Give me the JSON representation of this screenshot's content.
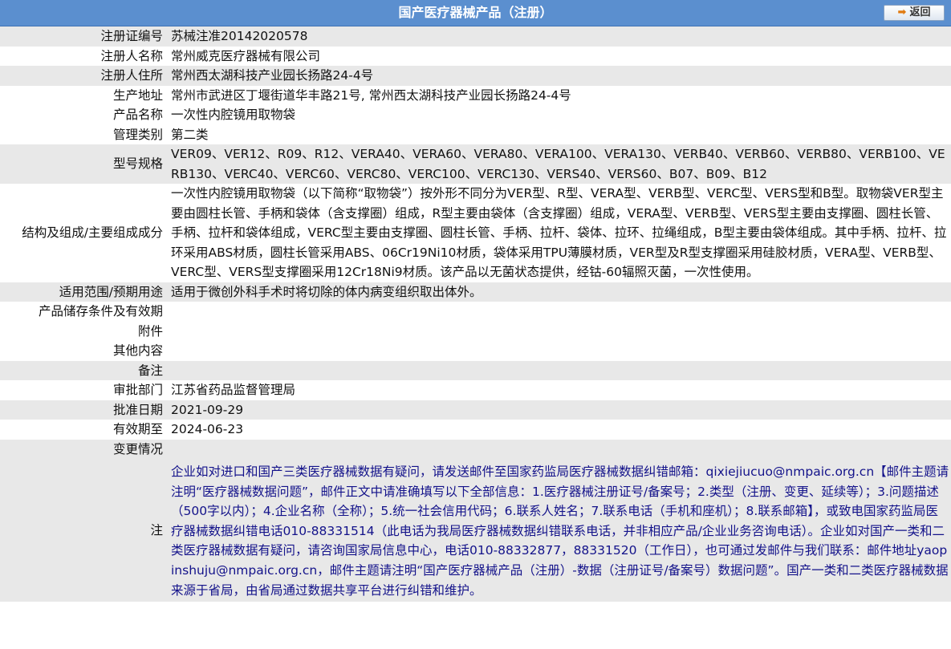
{
  "header": {
    "title": "国产医疗器械产品（注册）",
    "back_label": "返回"
  },
  "rows": [
    {
      "label": "注册证编号",
      "value": "苏械注准20142020578"
    },
    {
      "label": "注册人名称",
      "value": "常州威克医疗器械有限公司"
    },
    {
      "label": "注册人住所",
      "value": "常州西太湖科技产业园长扬路24-4号"
    },
    {
      "label": "生产地址",
      "value": "常州市武进区丁堰街道华丰路21号, 常州西太湖科技产业园长扬路24-4号"
    },
    {
      "label": "产品名称",
      "value": "一次性内腔镜用取物袋"
    },
    {
      "label": "管理类别",
      "value": "第二类"
    },
    {
      "label": "型号规格",
      "value": "VER09、VER12、R09、R12、VERA40、VERA60、VERA80、VERA100、VERA130、VERB40、VERB60、VERB80、VERB100、VERB130、VERC40、VERC60、VERC80、VERC100、VERC130、VERS40、VERS60、B07、B09、B12"
    },
    {
      "label": "结构及组成/主要组成成分",
      "value": "一次性内腔镜用取物袋（以下简称“取物袋”）按外形不同分为VER型、R型、VERA型、VERB型、VERC型、VERS型和B型。取物袋VER型主要由圆柱长管、手柄和袋体（含支撑圈）组成，R型主要由袋体（含支撑圈）组成，VERA型、VERB型、VERS型主要由支撑圈、圆柱长管、手柄、拉杆和袋体组成，VERC型主要由支撑圈、圆柱长管、手柄、拉杆、袋体、拉环、拉绳组成，B型主要由袋体组成。其中手柄、拉杆、拉环采用ABS材质，圆柱长管采用ABS、06Cr19Ni10材质，袋体采用TPU薄膜材质，VER型及R型支撑圈采用硅胶材质，VERA型、VERB型、VERC型、VERS型支撑圈采用12Cr18Ni9材质。该产品以无菌状态提供，经钴-60辐照灭菌，一次性使用。"
    },
    {
      "label": "适用范围/预期用途",
      "value": "适用于微创外科手术时将切除的体内病变组织取出体外。"
    },
    {
      "label": "产品储存条件及有效期",
      "value": ""
    },
    {
      "label": "附件",
      "value": ""
    },
    {
      "label": "其他内容",
      "value": ""
    },
    {
      "label": "备注",
      "value": ""
    },
    {
      "label": "审批部门",
      "value": "江苏省药品监督管理局"
    },
    {
      "label": "批准日期",
      "value": "2021-09-29"
    },
    {
      "label": "有效期至",
      "value": "2024-06-23"
    },
    {
      "label": "变更情况",
      "value": ""
    }
  ],
  "note": {
    "label": "注",
    "text": "企业如对进口和国产三类医疗器械数据有疑问，请发送邮件至国家药监局医疗器械数据纠错邮箱：qixiejiucuo@nmpaic.org.cn【邮件主题请注明“医疗器械数据问题”，邮件正文中请准确填写以下全部信息：1.医疗器械注册证号/备案号；2.类型（注册、变更、延续等）；3.问题描述（500字以内）；4.企业名称（全称）；5.统一社会信用代码；6.联系人姓名；7.联系电话（手机和座机）；8.联系邮箱】，或致电国家药监局医疗器械数据纠错电话010-88331514（此电话为我局医疗器械数据纠错联系电话，并非相应产品/企业业务咨询电话）。企业如对国产一类和二类医疗器械数据有疑问，请咨询国家局信息中心，电话010-88332877，88331520（工作日），也可通过发邮件与我们联系：邮件地址yaopinshuju@nmpaic.org.cn，邮件主题请注明“国产医疗器械产品（注册）-数据（注册证号/备案号）数据问题”。国产一类和二类医疗器械数据来源于省局，由省局通过数据共享平台进行纠错和维护。"
  },
  "colors": {
    "header_bg": "#5b8fcf",
    "row_gray": "#e8e8e8",
    "note_text": "#13128a"
  },
  "icons": {
    "back": "arrow-right-icon"
  }
}
